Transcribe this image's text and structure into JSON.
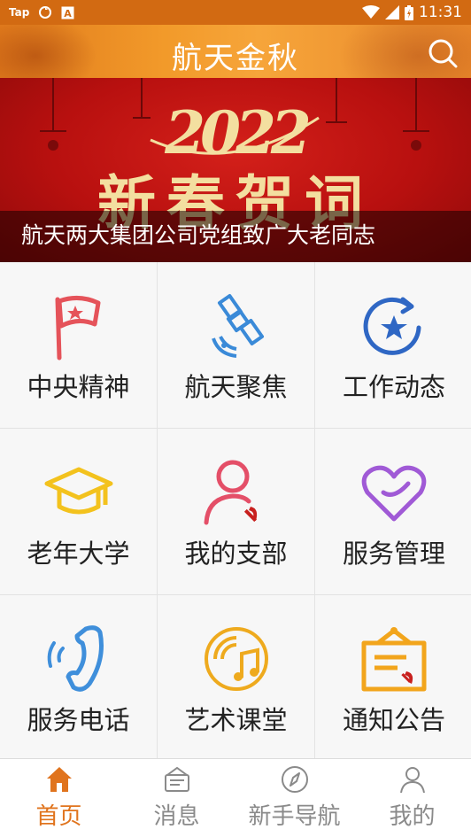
{
  "status_bar": {
    "left_text": "Tap",
    "time": "11:31"
  },
  "header": {
    "title": "航天金秋"
  },
  "banner": {
    "year": "2022",
    "headline": "新春贺词",
    "caption": "航天两大集团公司党组致广大老同志"
  },
  "grid": [
    {
      "label": "中央精神",
      "icon": "flag-icon",
      "color": "#e5535a"
    },
    {
      "label": "航天聚焦",
      "icon": "satellite-icon",
      "color": "#3a8ad8"
    },
    {
      "label": "工作动态",
      "icon": "refresh-star-icon",
      "color": "#2f67c4"
    },
    {
      "label": "老年大学",
      "icon": "graduation-cap-icon",
      "color": "#f3c21d"
    },
    {
      "label": "我的支部",
      "icon": "party-member-icon",
      "color": "#e44f68"
    },
    {
      "label": "服务管理",
      "icon": "heart-icon",
      "color": "#a05ad6"
    },
    {
      "label": "服务电话",
      "icon": "phone-icon",
      "color": "#3f8fdb"
    },
    {
      "label": "艺术课堂",
      "icon": "music-disc-icon",
      "color": "#eeaa1e"
    },
    {
      "label": "通知公告",
      "icon": "notice-board-icon",
      "color": "#f2a51c"
    }
  ],
  "bottom_nav": [
    {
      "label": "首页",
      "icon": "home-icon",
      "active": true
    },
    {
      "label": "消息",
      "icon": "message-icon",
      "active": false
    },
    {
      "label": "新手导航",
      "icon": "compass-icon",
      "active": false
    },
    {
      "label": "我的",
      "icon": "user-icon",
      "active": false
    }
  ],
  "colors": {
    "accent": "#e0741e",
    "header": "#f29a2a",
    "banner_red": "#c8140f"
  }
}
